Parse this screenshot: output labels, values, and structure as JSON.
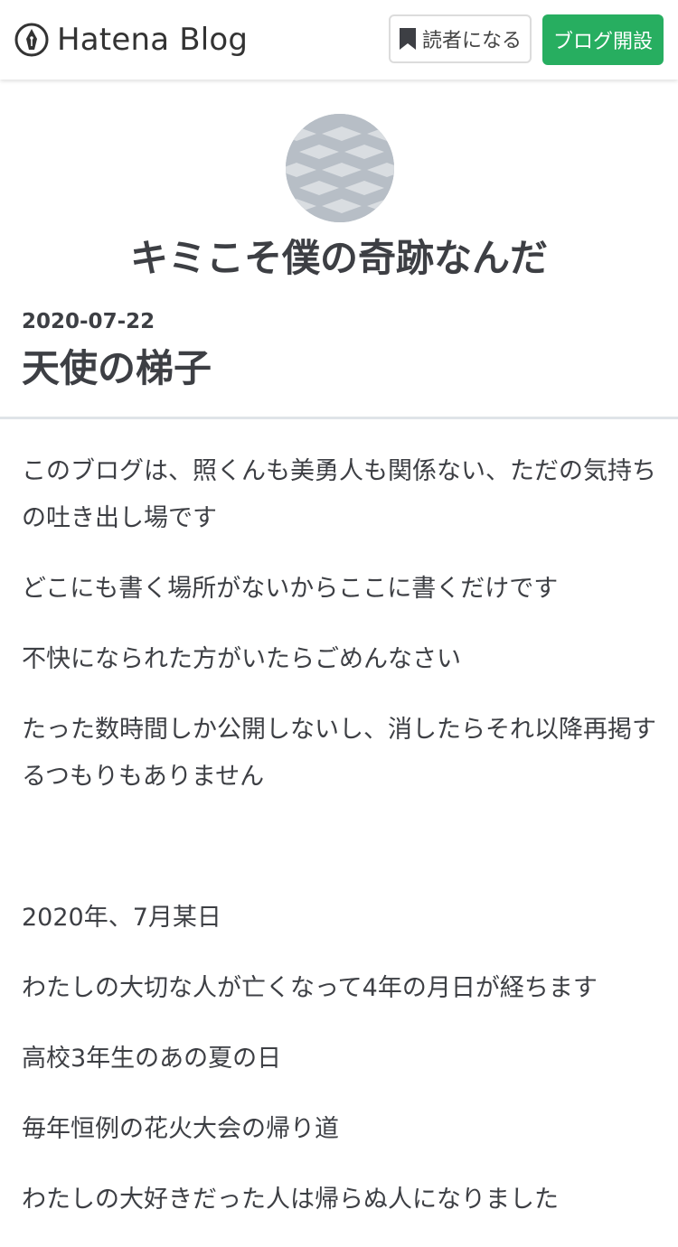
{
  "header": {
    "logo_text": "Hatena Blog",
    "subscribe_label": "読者になる",
    "open_blog_label": "ブログ開設"
  },
  "blog": {
    "title": "キミこそ僕の奇跡なんだ"
  },
  "entry": {
    "date": "2020-07-22",
    "title": "天使の梯子",
    "paragraphs": [
      "このブログは、照くんも美勇人も関係ない、ただの気持ちの吐き出し場です",
      "どこにも書く場所がないからここに書くだけです",
      "不快になられた方がいたらごめんなさい",
      "たった数時間しか公開しないし、消したらそれ以降再掲するつもりもありません",
      "",
      "2020年、7月某日",
      "わたしの大切な人が亡くなって4年の月日が経ちます",
      "高校3年生のあの夏の日",
      "毎年恒例の花火大会の帰り道",
      "わたしの大好きだった人は帰らぬ人になりました"
    ]
  },
  "colors": {
    "accent_green": "#27ae60",
    "text": "#3d3f44",
    "divider": "#dfe4e8"
  }
}
